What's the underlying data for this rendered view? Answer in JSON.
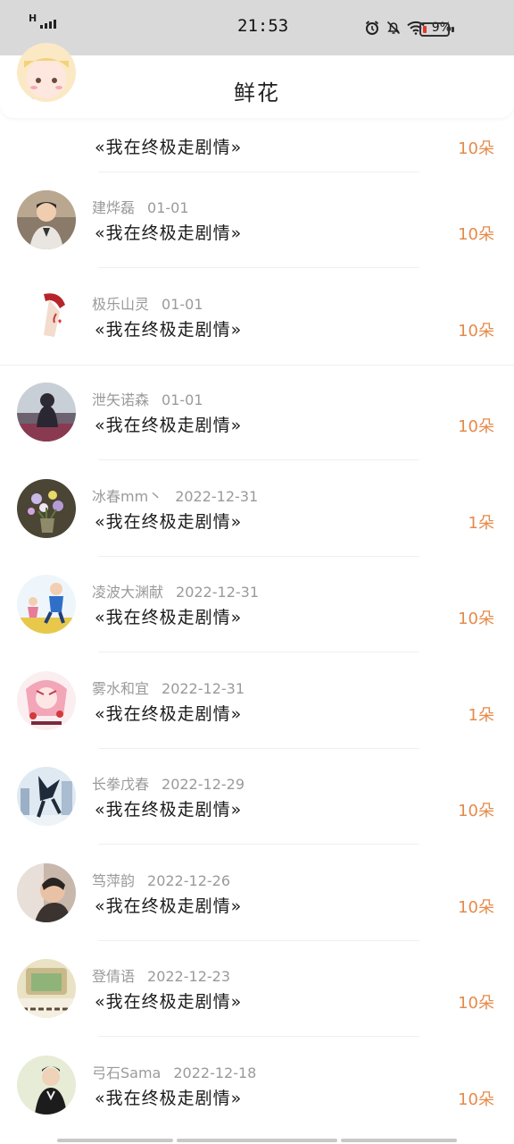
{
  "status_bar": {
    "network": "H",
    "time": "21:53",
    "battery_percent": "9%"
  },
  "header": {
    "title": "鲜花"
  },
  "colors": {
    "accent": "#2f8de0",
    "amount": "#e58a4a",
    "meta": "#9a9a9a"
  },
  "items": [
    {
      "name": "",
      "date": "",
      "book": "«我在终极走剧情»",
      "amount": "10朵"
    },
    {
      "name": "建烨磊",
      "date": "01-01",
      "book": "«我在终极走剧情»",
      "amount": "10朵"
    },
    {
      "name": "极乐山灵",
      "date": "01-01",
      "book": "«我在终极走剧情»",
      "amount": "10朵"
    },
    {
      "name": "泄矢诺森",
      "date": "01-01",
      "book": "«我在终极走剧情»",
      "amount": "10朵"
    },
    {
      "name": "冰春mm丶",
      "date": "2022-12-31",
      "book": "«我在终极走剧情»",
      "amount": "1朵"
    },
    {
      "name": "凌波大渊献",
      "date": "2022-12-31",
      "book": "«我在终极走剧情»",
      "amount": "10朵"
    },
    {
      "name": "雾水和宜",
      "date": "2022-12-31",
      "book": "«我在终极走剧情»",
      "amount": "1朵"
    },
    {
      "name": "长拳戊春",
      "date": "2022-12-29",
      "book": "«我在终极走剧情»",
      "amount": "10朵"
    },
    {
      "name": "笃萍韵",
      "date": "2022-12-26",
      "book": "«我在终极走剧情»",
      "amount": "10朵"
    },
    {
      "name": "登倩语",
      "date": "2022-12-23",
      "book": "«我在终极走剧情»",
      "amount": "10朵"
    },
    {
      "name": "弓石Sama",
      "date": "2022-12-18",
      "book": "«我在终极走剧情»",
      "amount": "10朵"
    }
  ]
}
